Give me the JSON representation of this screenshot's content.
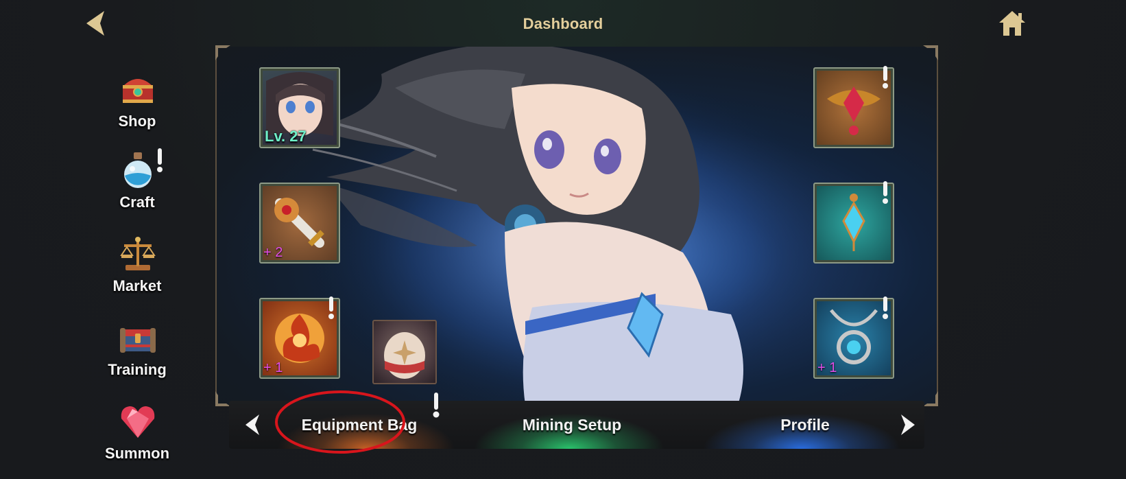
{
  "header": {
    "title": "Dashboard",
    "back_icon": "back-arrow-icon",
    "home_icon": "home-icon"
  },
  "sidebar": {
    "items": [
      {
        "label": "Shop",
        "icon": "treasure-chest-icon",
        "alert": false
      },
      {
        "label": "Craft",
        "icon": "potion-flask-icon",
        "alert": true
      },
      {
        "label": "Market",
        "icon": "balance-scale-icon",
        "alert": false
      },
      {
        "label": "Training",
        "icon": "training-chest-icon",
        "alert": false
      },
      {
        "label": "Summon",
        "icon": "heart-gem-icon",
        "alert": false
      }
    ]
  },
  "equipment": {
    "left_slots": [
      {
        "name": "character-portrait",
        "level_text": "Lv. 27",
        "alert": false
      },
      {
        "name": "weapon",
        "plus": "+ 2",
        "alert": false
      },
      {
        "name": "emblem",
        "plus": "+ 1",
        "alert": true
      }
    ],
    "right_slots": [
      {
        "name": "crest",
        "alert": true
      },
      {
        "name": "earring",
        "alert": true
      },
      {
        "name": "necklace",
        "plus": "+ 1",
        "alert": true
      }
    ],
    "extra_slot": {
      "name": "pet-egg"
    }
  },
  "tabs": {
    "items": [
      {
        "label": "Equipment Bag",
        "active": true,
        "glow": "#ff7a2a"
      },
      {
        "label": "Mining Setup",
        "active": false,
        "glow": "#2ee07a"
      },
      {
        "label": "Profile",
        "active": false,
        "glow": "#2d7bff"
      }
    ],
    "prev_icon": "chevron-left-icon",
    "next_icon": "chevron-right-icon",
    "alert_on_tab": 0
  },
  "colors": {
    "title_gold": "#e4cf9c",
    "alert_white": "#f4f4f4",
    "plus_magenta": "#e24de8",
    "level_teal": "#6ff0c9",
    "highlight_red": "#d8151c"
  }
}
